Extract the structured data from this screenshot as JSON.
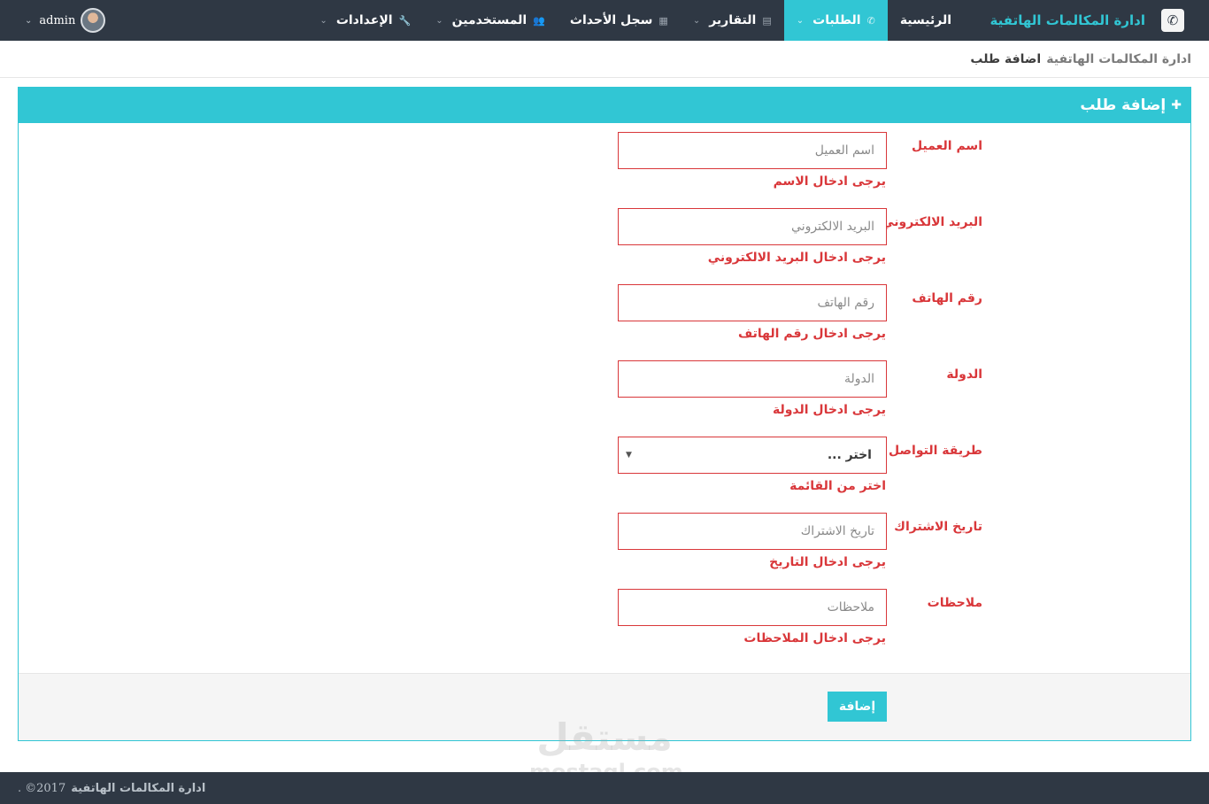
{
  "navbar": {
    "brand_title": "ادارة المكالمات الهاتفية",
    "brand_icon": "phone-logo-icon",
    "items": [
      {
        "label": "الرئيسية",
        "icon": "",
        "caret": false,
        "active": false
      },
      {
        "label": "الطلبات",
        "icon": "phone-icon",
        "caret": true,
        "active": true
      },
      {
        "label": "التقارير",
        "icon": "file-icon",
        "caret": true,
        "active": false
      },
      {
        "label": "سجل الأحداث",
        "icon": "calendar-icon",
        "caret": false,
        "active": false
      },
      {
        "label": "المستخدمين",
        "icon": "users-icon",
        "caret": true,
        "active": false
      },
      {
        "label": "الإعدادات",
        "icon": "wrench-icon",
        "caret": true,
        "active": false
      }
    ],
    "user": {
      "name": "admin"
    }
  },
  "breadcrumb": {
    "root": "ادارة المكالمات الهاتفية",
    "current": "اضافة طلب"
  },
  "panel": {
    "title": "إضافة طلب",
    "fields": [
      {
        "label": "اسم العميل",
        "placeholder": "اسم العميل",
        "error": "يرجى ادخال الاسم"
      },
      {
        "label": "البريد الالكتروني",
        "placeholder": "البريد الالكتروني",
        "error": "يرجى ادخال البريد الالكتروني"
      },
      {
        "label": "رقم الهاتف",
        "placeholder": "رقم الهاتف",
        "error": "يرجى ادخال رقم الهاتف"
      },
      {
        "label": "الدولة",
        "placeholder": "الدولة",
        "error": "يرجى ادخال الدولة"
      },
      {
        "label": "طريقة التواصل معنا",
        "select_value": "اختر ...",
        "error": "اختر من القائمة"
      },
      {
        "label": "تاريخ الاشتراك",
        "placeholder": "تاريخ الاشتراك",
        "error": "يرجى ادخال التاريخ"
      },
      {
        "label": "ملاحظات",
        "placeholder": "ملاحظات",
        "error": "يرجى ادخال الملاحظات"
      }
    ],
    "submit_label": "إضافة"
  },
  "footer": {
    "text": "ادارة المكالمات الهاتفية",
    "copyright": "©2017",
    "dot": "."
  },
  "watermark": {
    "arabic": "مستقل",
    "latin": "mostaql.com"
  },
  "colors": {
    "navbar_bg": "#2f3844",
    "accent": "#31c6d4",
    "error": "#d9373a"
  }
}
